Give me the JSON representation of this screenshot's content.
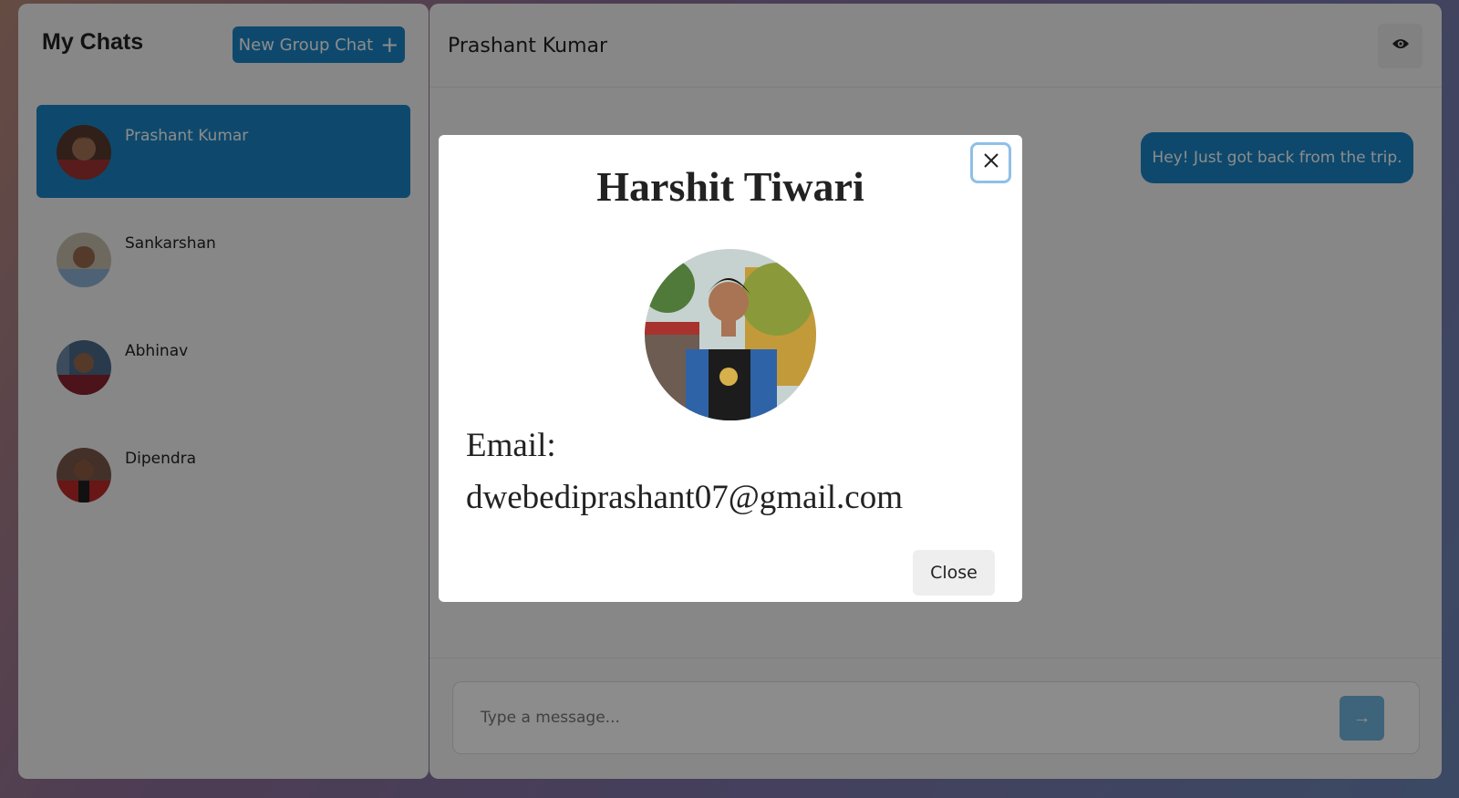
{
  "sidebar": {
    "title": "My Chats",
    "new_group_label": "New Group Chat",
    "chats": [
      {
        "name": "Prashant Kumar",
        "active": true
      },
      {
        "name": "Sankarshan",
        "active": false
      },
      {
        "name": "Abhinav",
        "active": false
      },
      {
        "name": "Dipendra",
        "active": false
      }
    ]
  },
  "main": {
    "title": "Prashant Kumar",
    "messages": [
      {
        "text": "Hey! Just got back from the trip.",
        "sender": "self"
      }
    ],
    "input_placeholder": "Type a message...",
    "send_icon": "arrow-right-icon"
  },
  "modal": {
    "title": "Harshit Tiwari",
    "email_label": "Email:",
    "email_value": "dwebediprashant07@gmail.com",
    "close_label": "Close"
  },
  "colors": {
    "accent": "#1a86c6",
    "send_button": "#6fb6e0"
  }
}
